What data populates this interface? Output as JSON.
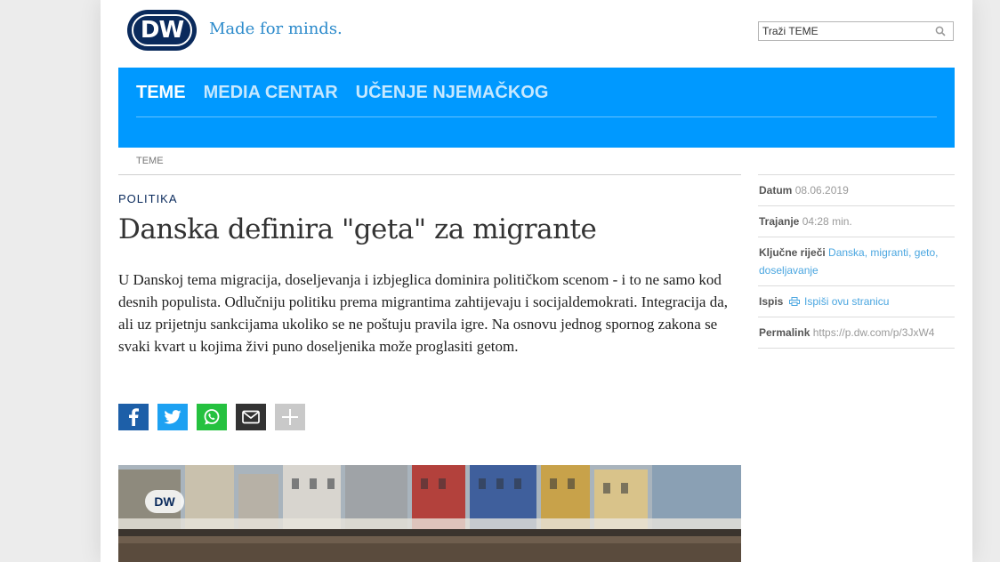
{
  "header": {
    "logo_text": "DW",
    "tagline": "Made for minds.",
    "search_placeholder": "Traži TEME"
  },
  "nav": {
    "items": [
      {
        "label": "TEME",
        "active": true
      },
      {
        "label": "MEDIA CENTAR",
        "active": false
      },
      {
        "label": "UČENJE NJEMAČKOG",
        "active": false
      }
    ]
  },
  "breadcrumb": "TEME",
  "article": {
    "kicker": "POLITIKA",
    "title": "Danska definira \"geta\" za migrante",
    "lead": "U Danskoj tema migracija, doseljevanja i izbjeglica dominira političkom scenom - i to ne samo kod desnih populista. Odlučniju politiku prema migrantima zahtijevaju i socijaldemokrati. Integracija da, ali uz prijetnju sankcijama ukoliko se ne poštuju pravila igre. Na osnovu jednog spornog zakona se svaki kvart u kojima živi puno doseljenika može proglasiti getom.",
    "share_icons": [
      "facebook-icon",
      "twitter-icon",
      "whatsapp-icon",
      "mail-icon",
      "plus-icon"
    ],
    "photo_bug": "DW"
  },
  "sidebar": {
    "date_label": "Datum",
    "date_value": "08.06.2019",
    "duration_label": "Trajanje",
    "duration_value": "04:28 min.",
    "keywords_label": "Ključne riječi",
    "keywords": [
      "Danska",
      "migranti",
      "geto",
      "doseljavanje"
    ],
    "print_label": "Ispis",
    "print_link": "Ispiši ovu stranicu",
    "permalink_label": "Permalink",
    "permalink_value": "https://p.dw.com/p/3JxW4"
  },
  "colors": {
    "nav_bg": "#0099ff",
    "brand_navy": "#0a2a5c",
    "link": "#4aa6e0"
  }
}
